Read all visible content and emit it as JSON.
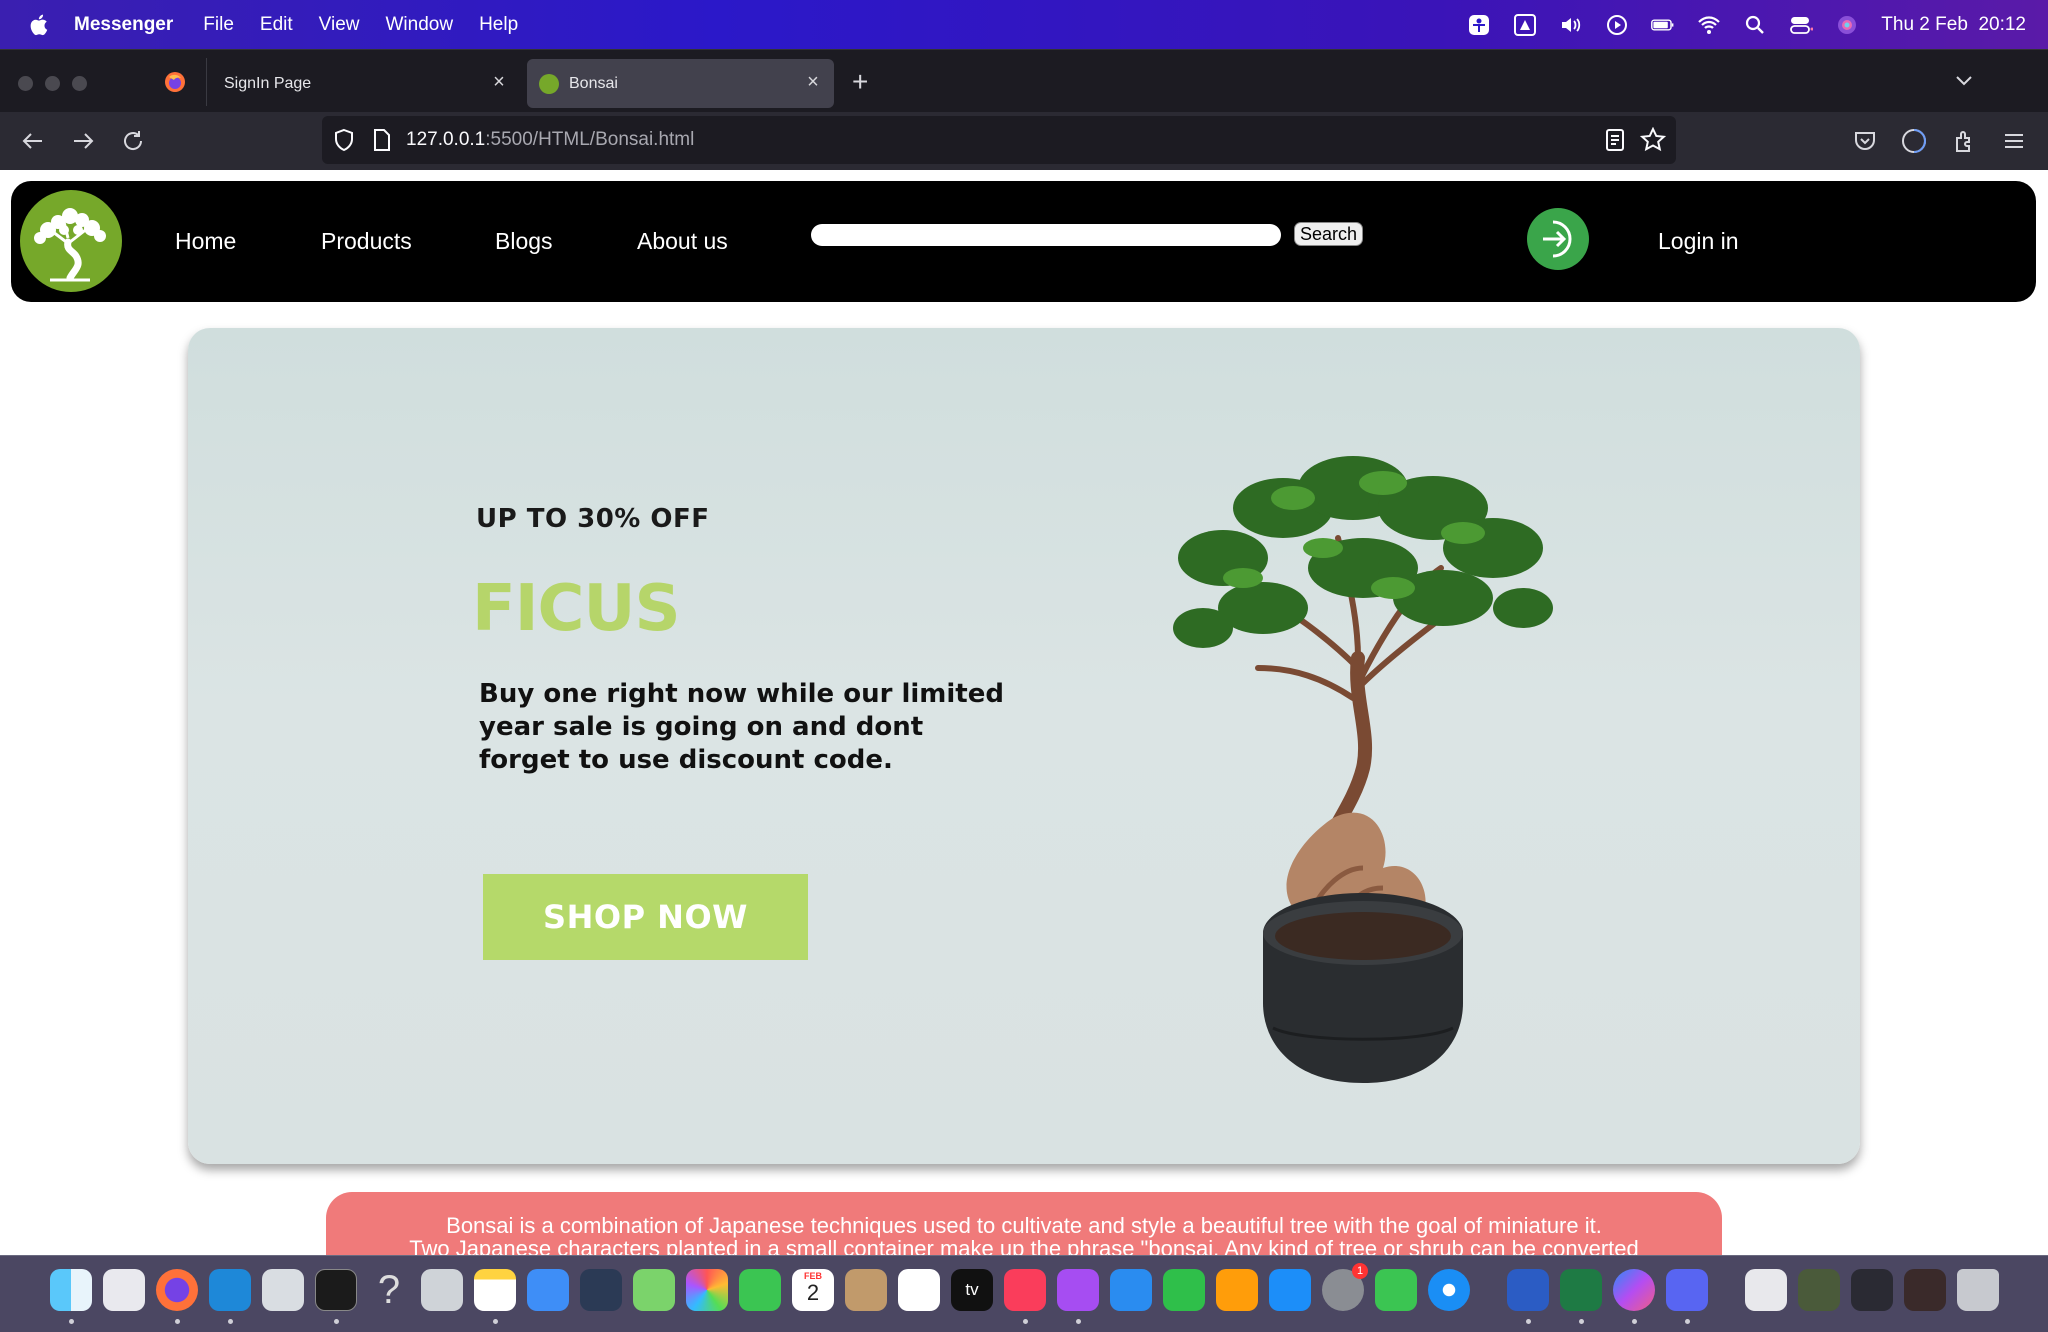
{
  "menubar": {
    "app_name": "Messenger",
    "items": [
      "File",
      "Edit",
      "View",
      "Window",
      "Help"
    ],
    "datetime": "Thu 2 Feb  20:12"
  },
  "browser": {
    "tabs": [
      {
        "title": "SignIn Page",
        "active": false
      },
      {
        "title": "Bonsai",
        "active": true
      }
    ],
    "url_host": "127.0.0.1",
    "url_path": ":5500/HTML/Bonsai.html"
  },
  "nav": {
    "links": [
      "Home",
      "Products",
      "Blogs",
      "About us"
    ],
    "search_placeholder": "",
    "search_button": "Search",
    "login_label": "Login in"
  },
  "hero": {
    "promo": "UP TO 30% OFF",
    "title": "FICUS",
    "description": "Buy one right now while our limited year sale is going on and dont forget to use discount code.",
    "cta": "SHOP NOW"
  },
  "info": {
    "line1": "Bonsai is a combination of Japanese techniques used to cultivate and style a beautiful tree with the goal of miniature it.",
    "line2": "Two Japanese characters planted in a small container make up the phrase \"bonsai. Any kind of tree or shrub can be converted"
  },
  "colors": {
    "menubar": "#2b18c9",
    "nav_bg": "#000000",
    "accent_green": "#b5d96a",
    "login_green": "#3aa54a",
    "info_bg": "#f07a7a"
  },
  "dock": {
    "icons": [
      "finder-icon",
      "launchpad-icon",
      "firefox-icon",
      "vscode-icon",
      "pigeon-icon",
      "terminal-icon",
      "help-icon",
      "settings-alt-icon",
      "notes-icon",
      "mail-icon",
      "netbeans-icon",
      "maps-icon",
      "photos-icon",
      "facetime-icon",
      "calendar-icon",
      "contacts-icon",
      "reminders-icon",
      "appletv-icon",
      "music-icon",
      "podcasts-icon",
      "keynote-icon",
      "numbers-icon",
      "pages-icon",
      "appstore-icon",
      "system-settings-icon",
      "messages-icon",
      "safari-icon",
      "word-icon",
      "excel-icon",
      "messenger-icon",
      "discord-icon",
      "preview-icon",
      "screenshot-icon",
      "window-icon",
      "window2-icon",
      "trash-icon"
    ],
    "calendar_month": "FEB",
    "calendar_day": "2",
    "appletv_label": "tv",
    "system_settings_badge": "1"
  }
}
